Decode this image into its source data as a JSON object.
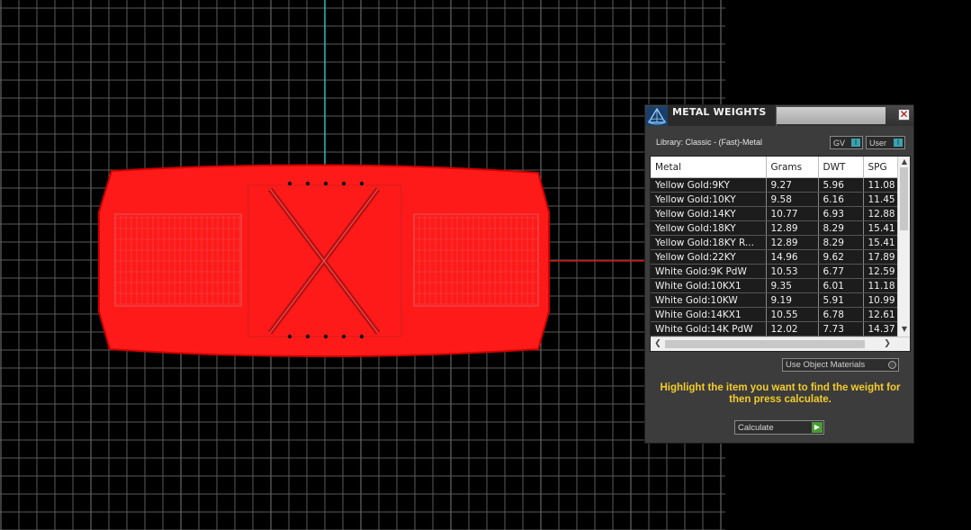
{
  "panel": {
    "title": "METAL WEIGHTS",
    "close_icon": "close-icon",
    "app_icon": "pyramid-app-icon",
    "library_label": "Library: Classic - (Fast)-Metal",
    "toggle_gv": {
      "label": "GV",
      "state": "I"
    },
    "toggle_user": {
      "label": "User",
      "state": "I"
    },
    "table": {
      "columns": [
        "Metal",
        "Grams",
        "DWT",
        "SPG"
      ],
      "rows": [
        [
          "Yellow Gold:9KY",
          "9.27",
          "5.96",
          "11.08"
        ],
        [
          "Yellow Gold:10KY",
          "9.58",
          "6.16",
          "11.45"
        ],
        [
          "Yellow Gold:14KY",
          "10.77",
          "6.93",
          "12.88"
        ],
        [
          "Yellow Gold:18KY",
          "12.89",
          "8.29",
          "15.41"
        ],
        [
          "Yellow Gold:18KY R...",
          "12.89",
          "8.29",
          "15.41"
        ],
        [
          "Yellow Gold:22KY",
          "14.96",
          "9.62",
          "17.89"
        ],
        [
          "White Gold:9K PdW",
          "10.53",
          "6.77",
          "12.59"
        ],
        [
          "White Gold:10KX1",
          "9.35",
          "6.01",
          "11.18"
        ],
        [
          "White Gold:10KW",
          "9.19",
          "5.91",
          "10.99"
        ],
        [
          "White Gold:14KX1",
          "10.55",
          "6.78",
          "12.61"
        ],
        [
          "White Gold:14K PdW",
          "12.02",
          "7.73",
          "14.37"
        ]
      ]
    },
    "use_object_materials": "Use Object Materials",
    "instruction": "Highlight the item you want to find the weight for then press calculate.",
    "calculate_label": "Calculate",
    "colors": {
      "instruction": "#f4cc2c",
      "model": "#ff0000",
      "grid": "#5a5a5a"
    }
  }
}
